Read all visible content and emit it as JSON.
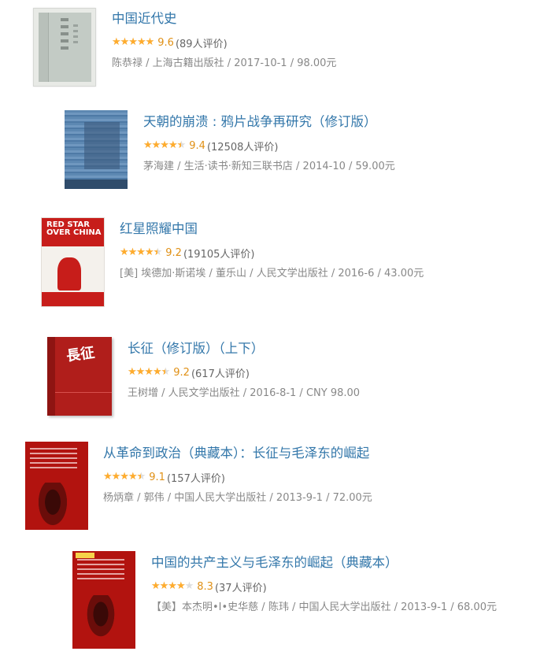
{
  "books": [
    {
      "title": "中国近代史",
      "rating": 9.6,
      "score": "9.6",
      "votes": "(89人评价)",
      "pub": "陈恭禄 / 上海古籍出版社 / 2017-10-1 / 98.00元"
    },
    {
      "title": "天朝的崩溃 : 鸦片战争再研究（修订版）",
      "rating": 9.4,
      "score": "9.4",
      "votes": "(12508人评价)",
      "pub": "茅海建 / 生活·读书·新知三联书店 / 2014-10 / 59.00元"
    },
    {
      "title": "红星照耀中国",
      "rating": 9.2,
      "score": "9.2",
      "votes": "(19105人评价)",
      "pub": "[美] 埃德加·斯诺埃 / 董乐山 / 人民文学出版社 / 2016-6 / 43.00元",
      "cover_text": "RED STAR OVER CHINA"
    },
    {
      "title": "长征（修订版）（上下）",
      "rating": 9.2,
      "score": "9.2",
      "votes": "(617人评价)",
      "pub": "王树增 / 人民文学出版社 / 2016-8-1 / CNY 98.00"
    },
    {
      "title": "从革命到政治（典藏本）：长征与毛泽东的崛起",
      "rating": 9.1,
      "score": "9.1",
      "votes": "(157人评价)",
      "pub": "杨炳章 / 郭伟 / 中国人民大学出版社 / 2013-9-1 / 72.00元"
    },
    {
      "title": "中国的共产主义与毛泽东的崛起（典藏本）",
      "rating": 8.3,
      "score": "8.3",
      "votes": "(37人评价)",
      "pub": "【美】本杰明•I•史华慈 / 陈玮 / 中国人民大学出版社 / 2013-9-1 / 68.00元"
    }
  ],
  "star_glyphs": "★★★★★",
  "colors": {
    "title_link": "#3377aa",
    "score": "#e09015",
    "star": "#ffac2d",
    "meta": "#888888"
  },
  "icons": {
    "star": "star-icon"
  }
}
